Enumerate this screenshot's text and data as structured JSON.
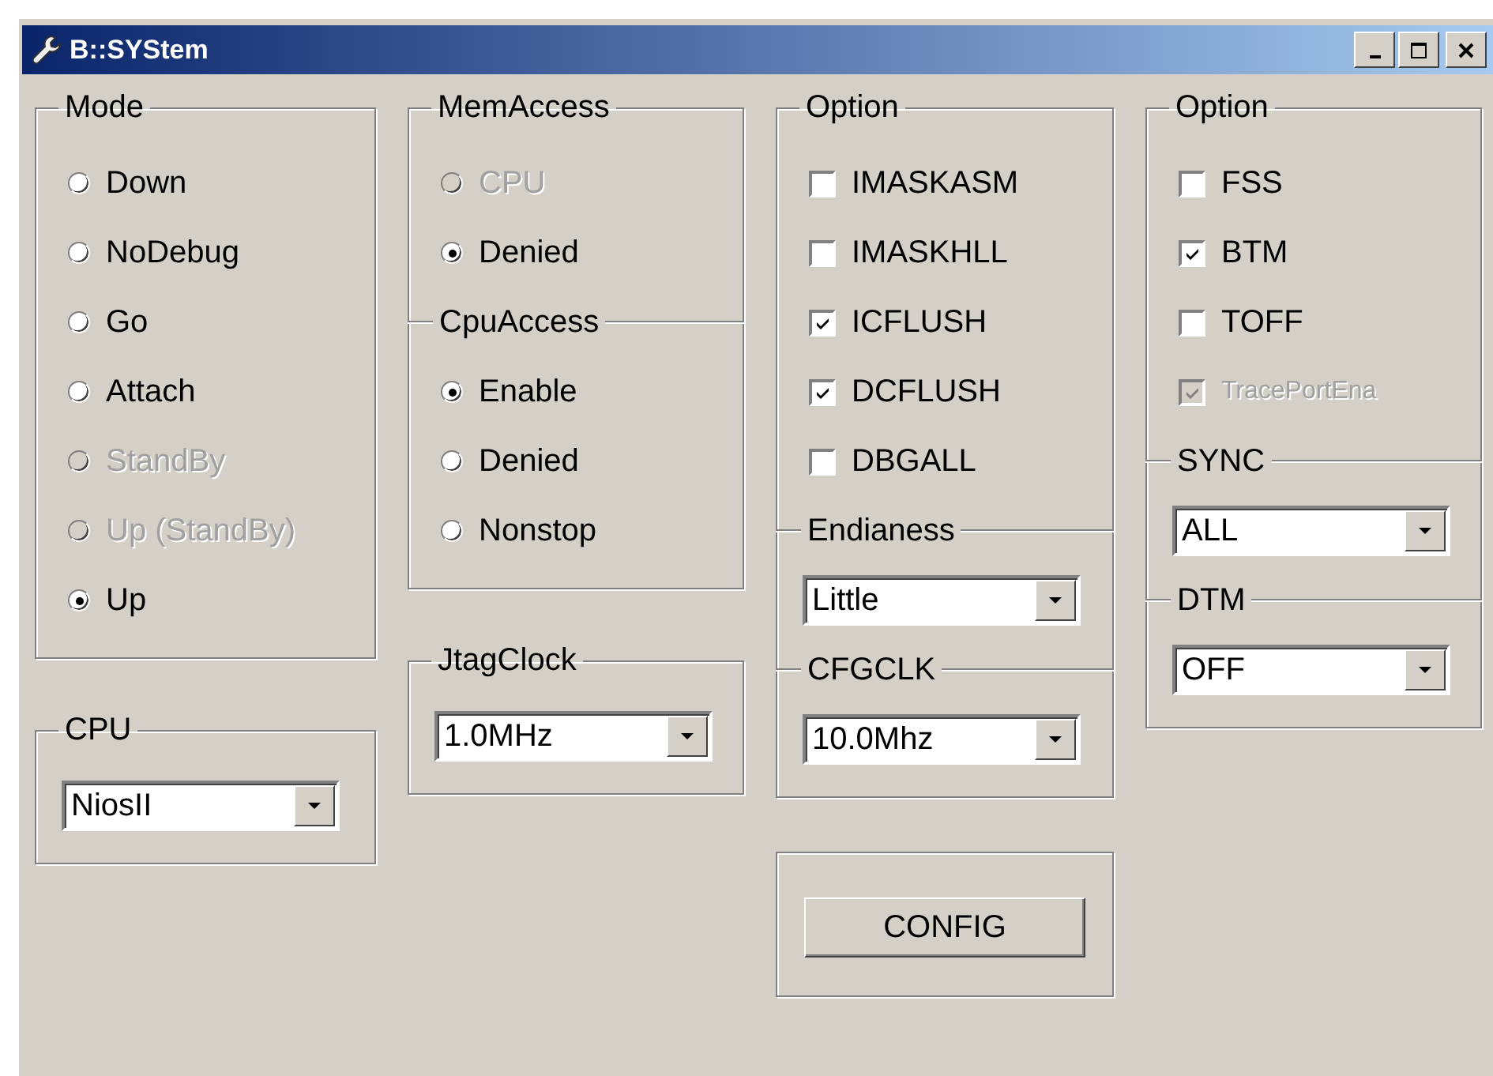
{
  "window": {
    "title": "B::SYStem"
  },
  "columns": [
    {
      "groups": [
        {
          "sections": [
            {
              "title": "Mode",
              "controls": [
                {
                  "kind": "radio",
                  "label": "Down",
                  "selected": false,
                  "disabled": false
                },
                {
                  "kind": "radio",
                  "label": "NoDebug",
                  "selected": false,
                  "disabled": false
                },
                {
                  "kind": "radio",
                  "label": "Go",
                  "selected": false,
                  "disabled": false
                },
                {
                  "kind": "radio",
                  "label": "Attach",
                  "selected": false,
                  "disabled": false
                },
                {
                  "kind": "radio",
                  "label": "StandBy",
                  "selected": false,
                  "disabled": true
                },
                {
                  "kind": "radio",
                  "label": "Up (StandBy)",
                  "selected": false,
                  "disabled": true
                },
                {
                  "kind": "radio",
                  "label": "Up",
                  "selected": true,
                  "disabled": false
                }
              ]
            }
          ]
        },
        {
          "sections": [
            {
              "title": "CPU",
              "controls": [
                {
                  "kind": "combo",
                  "value": "NiosII"
                }
              ]
            }
          ]
        }
      ]
    },
    {
      "groups": [
        {
          "sections": [
            {
              "title": "MemAccess",
              "controls": [
                {
                  "kind": "radio",
                  "label": "CPU",
                  "selected": false,
                  "disabled": true
                },
                {
                  "kind": "radio",
                  "label": "Denied",
                  "selected": true,
                  "disabled": false
                }
              ]
            },
            {
              "title": "CpuAccess",
              "controls": [
                {
                  "kind": "radio",
                  "label": "Enable",
                  "selected": true,
                  "disabled": false
                },
                {
                  "kind": "radio",
                  "label": "Denied",
                  "selected": false,
                  "disabled": false
                },
                {
                  "kind": "radio",
                  "label": "Nonstop",
                  "selected": false,
                  "disabled": false
                }
              ]
            }
          ]
        },
        {
          "sections": [
            {
              "title": "JtagClock",
              "controls": [
                {
                  "kind": "combo",
                  "value": "1.0MHz"
                }
              ]
            }
          ]
        }
      ]
    },
    {
      "groups": [
        {
          "sections": [
            {
              "title": "Option",
              "controls": [
                {
                  "kind": "checkbox",
                  "label": "IMASKASM",
                  "checked": false,
                  "disabled": false
                },
                {
                  "kind": "checkbox",
                  "label": "IMASKHLL",
                  "checked": false,
                  "disabled": false
                },
                {
                  "kind": "checkbox",
                  "label": "ICFLUSH",
                  "checked": true,
                  "disabled": false
                },
                {
                  "kind": "checkbox",
                  "label": "DCFLUSH",
                  "checked": true,
                  "disabled": false
                },
                {
                  "kind": "checkbox",
                  "label": "DBGALL",
                  "checked": false,
                  "disabled": false
                }
              ]
            },
            {
              "title": "Endianess",
              "controls": [
                {
                  "kind": "combo",
                  "value": "Little"
                }
              ]
            },
            {
              "title": "CFGCLK",
              "controls": [
                {
                  "kind": "combo",
                  "value": "10.0Mhz"
                }
              ]
            }
          ]
        },
        {
          "sections": [
            {
              "controls": [
                {
                  "kind": "button",
                  "label": "CONFIG"
                }
              ]
            }
          ]
        }
      ]
    },
    {
      "groups": [
        {
          "sections": [
            {
              "title": "Option",
              "controls": [
                {
                  "kind": "checkbox",
                  "label": "FSS",
                  "checked": false,
                  "disabled": false
                },
                {
                  "kind": "checkbox",
                  "label": "BTM",
                  "checked": true,
                  "disabled": false
                },
                {
                  "kind": "checkbox",
                  "label": "TOFF",
                  "checked": false,
                  "disabled": false
                },
                {
                  "kind": "checkbox",
                  "label": "TracePortEna",
                  "checked": true,
                  "disabled": true
                }
              ]
            },
            {
              "title": "SYNC",
              "controls": [
                {
                  "kind": "combo",
                  "value": "ALL"
                }
              ]
            },
            {
              "title": "DTM",
              "controls": [
                {
                  "kind": "combo",
                  "value": "OFF"
                }
              ]
            }
          ]
        }
      ]
    }
  ]
}
